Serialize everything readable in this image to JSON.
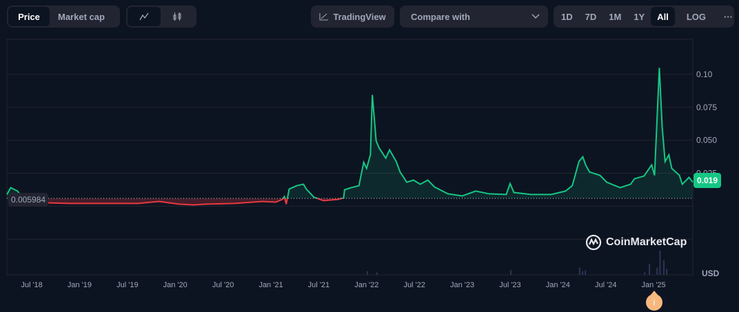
{
  "toolbar": {
    "data_tabs": [
      "Price",
      "Market cap"
    ],
    "active_data_tab": "Price",
    "chart_types": [
      "line-chart-icon",
      "candlestick-icon"
    ],
    "tradingview_label": "TradingView",
    "compare_placeholder": "Compare with",
    "ranges": [
      "1D",
      "7D",
      "1M",
      "1Y",
      "All"
    ],
    "active_range": "All",
    "log_label": "LOG",
    "more_label": "···"
  },
  "currency_label": "USD",
  "watermark": "CoinMarketCap",
  "info_marker": "i",
  "colors": {
    "up": "#16c784",
    "down": "#ea3943",
    "grid": "#222531",
    "bg": "#0d1421"
  },
  "chart_data": {
    "type": "line",
    "title": "",
    "xlabel": "",
    "ylabel": "USD",
    "baseline": 0.005984,
    "baseline_label": "0.005984",
    "last_label": "0.019",
    "ylim": [
      -0.052,
      0.1266
    ],
    "xlim": [
      2018.24,
      2025.41
    ],
    "y_ticks": [
      {
        "v": 0.1,
        "label": "0.10"
      },
      {
        "v": 0.075,
        "label": "0.075"
      },
      {
        "v": 0.05,
        "label": "0.050"
      },
      {
        "v": 0.025,
        "label": "0.025"
      }
    ],
    "x_ticks": [
      {
        "v": 2018.5,
        "label": "Jul '18"
      },
      {
        "v": 2019.0,
        "label": "Jan '19"
      },
      {
        "v": 2019.5,
        "label": "Jul '19"
      },
      {
        "v": 2020.0,
        "label": "Jan '20"
      },
      {
        "v": 2020.5,
        "label": "Jul '20"
      },
      {
        "v": 2021.0,
        "label": "Jan '21"
      },
      {
        "v": 2021.5,
        "label": "Jul '21"
      },
      {
        "v": 2022.0,
        "label": "Jan '22"
      },
      {
        "v": 2022.5,
        "label": "Jul '22"
      },
      {
        "v": 2023.0,
        "label": "Jan '23"
      },
      {
        "v": 2023.5,
        "label": "Jul '23"
      },
      {
        "v": 2024.0,
        "label": "Jan '24"
      },
      {
        "v": 2024.5,
        "label": "Jul '24"
      },
      {
        "v": 2025.0,
        "label": "Jan '25"
      }
    ],
    "x": [
      2018.24,
      2018.28,
      2018.35,
      2018.38,
      2018.46,
      2018.67,
      2018.89,
      2019.61,
      2019.83,
      2020.04,
      2020.19,
      2020.33,
      2020.62,
      2020.91,
      2021.05,
      2021.12,
      2021.14,
      2021.16,
      2021.18,
      2021.19,
      2021.27,
      2021.34,
      2021.37,
      2021.45,
      2021.55,
      2021.7,
      2021.76,
      2021.77,
      2021.84,
      2021.92,
      2021.97,
      2022.0,
      2022.04,
      2022.06,
      2022.1,
      2022.13,
      2022.2,
      2022.24,
      2022.31,
      2022.35,
      2022.42,
      2022.49,
      2022.56,
      2022.64,
      2022.71,
      2022.85,
      2023.0,
      2023.14,
      2023.28,
      2023.46,
      2023.5,
      2023.54,
      2023.72,
      2023.93,
      2024.08,
      2024.15,
      2024.22,
      2024.26,
      2024.29,
      2024.33,
      2024.44,
      2024.51,
      2024.65,
      2024.76,
      2024.8,
      2024.9,
      2024.98,
      2025.01,
      2025.06,
      2025.09,
      2025.12,
      2025.16,
      2025.19,
      2025.27,
      2025.3,
      2025.37,
      2025.41
    ],
    "y": [
      0.0089,
      0.0141,
      0.0115,
      0.0089,
      0.0042,
      0.0026,
      0.0021,
      0.0021,
      0.0036,
      0.0016,
      0.001,
      0.0016,
      0.0021,
      0.0036,
      0.0031,
      0.0052,
      0.0073,
      0.0016,
      0.0089,
      0.013,
      0.0156,
      0.0167,
      0.013,
      0.0068,
      0.0042,
      0.0052,
      0.0063,
      0.0125,
      0.0141,
      0.0156,
      0.0333,
      0.0287,
      0.039,
      0.0844,
      0.0495,
      0.0443,
      0.0365,
      0.0427,
      0.0339,
      0.026,
      0.0182,
      0.0198,
      0.0167,
      0.0198,
      0.0146,
      0.0094,
      0.0078,
      0.0115,
      0.0094,
      0.0089,
      0.0172,
      0.0104,
      0.0089,
      0.0089,
      0.0115,
      0.0156,
      0.0339,
      0.0375,
      0.0313,
      0.026,
      0.0234,
      0.0182,
      0.0141,
      0.0167,
      0.0208,
      0.0229,
      0.0313,
      0.0234,
      0.105,
      0.06,
      0.0339,
      0.039,
      0.0287,
      0.0234,
      0.0167,
      0.0219,
      0.0182
    ],
    "volume_relative": [
      {
        "x": 2022.0,
        "v": 0.15
      },
      {
        "x": 2022.1,
        "v": 0.1
      },
      {
        "x": 2023.5,
        "v": 0.2
      },
      {
        "x": 2024.22,
        "v": 0.3
      },
      {
        "x": 2024.25,
        "v": 0.15
      },
      {
        "x": 2024.28,
        "v": 0.18
      },
      {
        "x": 2024.95,
        "v": 0.45
      },
      {
        "x": 2025.03,
        "v": 0.3
      },
      {
        "x": 2025.06,
        "v": 1.0
      },
      {
        "x": 2025.1,
        "v": 0.6
      },
      {
        "x": 2025.13,
        "v": 0.25
      },
      {
        "x": 2024.9,
        "v": 0.1
      }
    ]
  }
}
